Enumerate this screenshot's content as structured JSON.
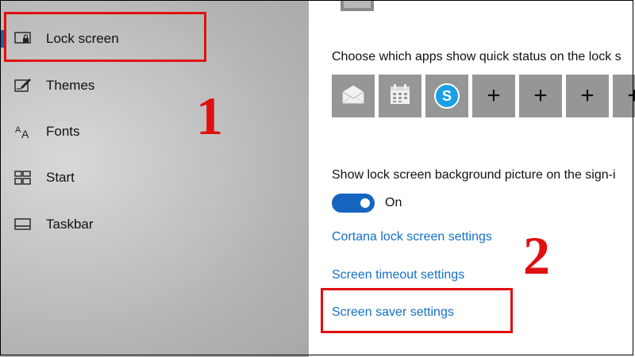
{
  "sidebar": {
    "items": [
      {
        "label": "Lock screen",
        "icon": "lock-screen-icon",
        "active": true
      },
      {
        "label": "Themes",
        "icon": "themes-icon"
      },
      {
        "label": "Fonts",
        "icon": "fonts-icon"
      },
      {
        "label": "Start",
        "icon": "start-icon"
      },
      {
        "label": "Taskbar",
        "icon": "taskbar-icon"
      }
    ]
  },
  "annotations": {
    "marker_1": "1",
    "marker_2": "2",
    "color": "#e01010"
  },
  "main": {
    "quick_status_heading": "Choose which apps show quick status on the lock s",
    "quick_status_tiles": [
      "mail-icon",
      "calendar-icon",
      "skype-icon",
      "add-icon",
      "add-icon",
      "add-icon",
      "add-icon"
    ],
    "signin_bg_label": "Show lock screen background picture on the sign-i",
    "signin_bg_toggle_state": "On",
    "links": {
      "cortana": "Cortana lock screen settings",
      "screen_timeout": "Screen timeout settings",
      "screen_saver": "Screen saver settings"
    }
  },
  "colors": {
    "accent": "#1565c0",
    "link": "#1570c8",
    "tile": "#969696"
  }
}
